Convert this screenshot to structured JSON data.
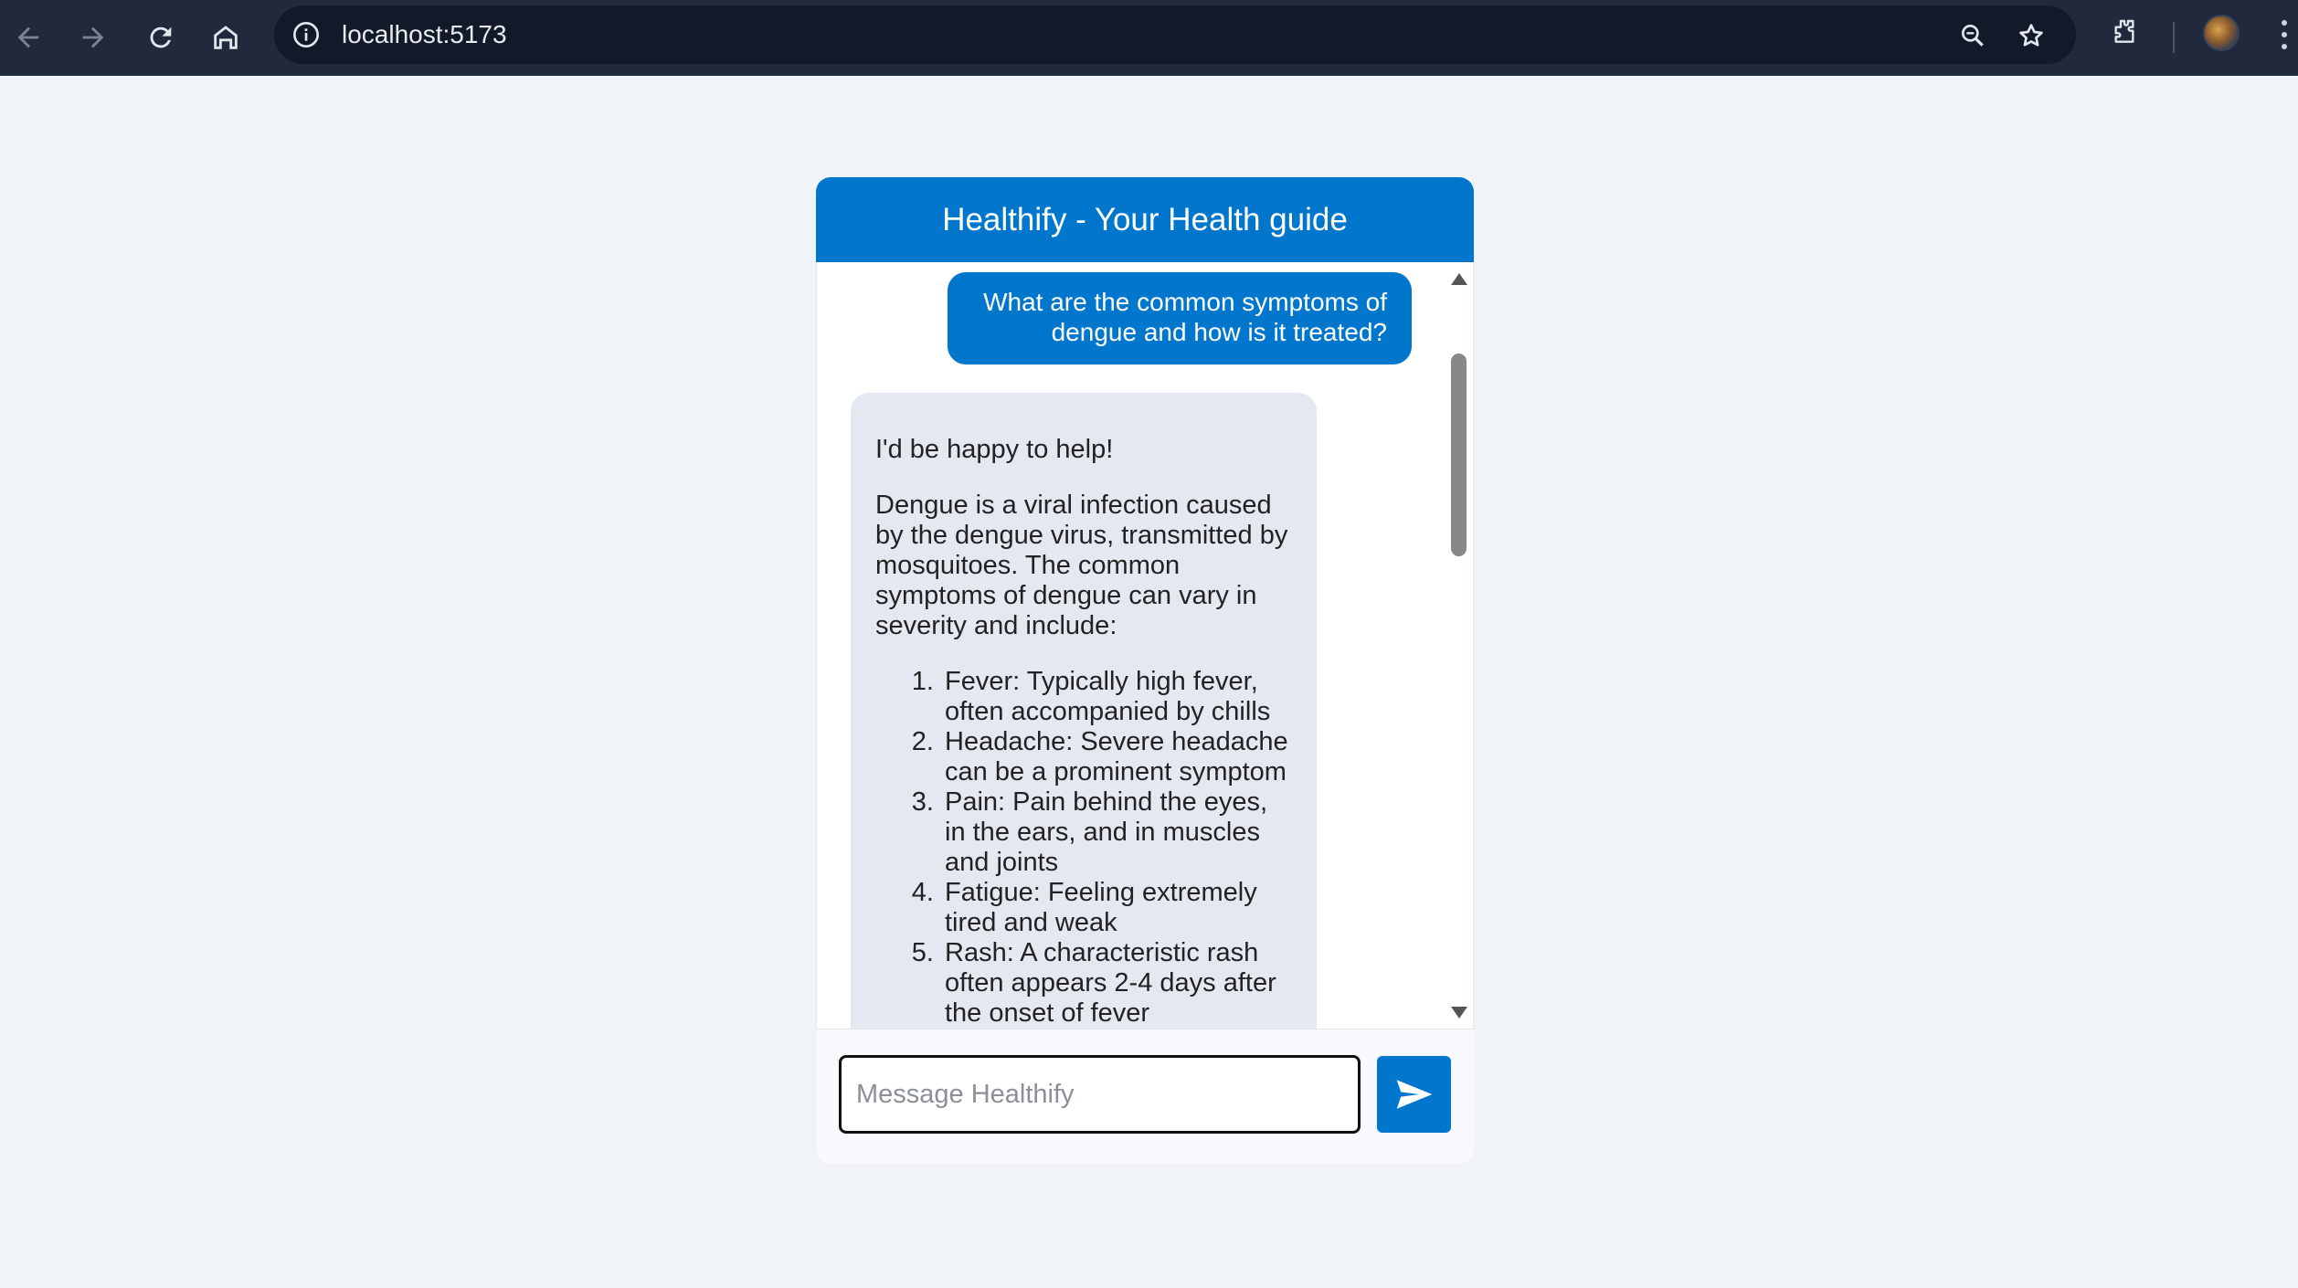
{
  "browser": {
    "url": "localhost:5173",
    "icons": [
      "back-arrow-icon",
      "forward-arrow-icon",
      "reload-icon",
      "home-icon",
      "site-info-icon",
      "zoom-icon",
      "bookmark-star-icon",
      "extensions-icon",
      "profile-avatar",
      "more-menu-icon"
    ]
  },
  "chat": {
    "title": "Healthify - Your Health guide",
    "user_message": "What are the common symptoms of dengue and how is it treated?",
    "bot_message": {
      "intro": "I'd be happy to help!",
      "paragraph": "Dengue is a viral infection caused by the dengue virus, transmitted by mosquitoes. The common symptoms of dengue can vary in severity and include:",
      "symptoms": [
        "Fever: Typically high fever, often accompanied by chills",
        "Headache: Severe headache can be a prominent symptom",
        "Pain: Pain behind the eyes, in the ears, and in muscles and joints",
        "Fatigue: Feeling extremely tired and weak",
        "Rash: A characteristic rash often appears 2-4 days after the onset of fever"
      ]
    },
    "input": {
      "placeholder": "Message Healthify",
      "value": ""
    },
    "send_icon": "send-icon"
  },
  "colors": {
    "accent": "#0077cc",
    "page_background": "#f0f3f8",
    "bot_bubble": "#e4e9f1",
    "chrome_background": "#202a3c"
  }
}
